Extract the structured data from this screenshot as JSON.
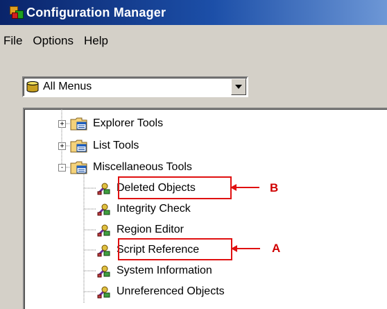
{
  "window": {
    "title": "Configuration Manager"
  },
  "menu": {
    "items": [
      "File",
      "Options",
      "Help"
    ]
  },
  "combo": {
    "value": "All Menus",
    "icon": "database-icon"
  },
  "tree": {
    "nodes": [
      {
        "label": "Explorer Tools",
        "type": "folder",
        "expander": "+"
      },
      {
        "label": "List Tools",
        "type": "folder",
        "expander": "+"
      },
      {
        "label": "Miscellaneous Tools",
        "type": "folder",
        "expander": "-"
      },
      {
        "label": "Deleted Objects",
        "type": "script",
        "annotation": "B"
      },
      {
        "label": "Integrity Check",
        "type": "script"
      },
      {
        "label": "Region Editor",
        "type": "script"
      },
      {
        "label": "Script Reference",
        "type": "script",
        "annotation": "A"
      },
      {
        "label": "System Information",
        "type": "script"
      },
      {
        "label": "Unreferenced Objects",
        "type": "script"
      }
    ]
  },
  "annotations": [
    {
      "letter": "B",
      "target": "Deleted Objects"
    },
    {
      "letter": "A",
      "target": "Script Reference"
    }
  ],
  "colors": {
    "titlebar_start": "#0a246a",
    "titlebar_end": "#6d97d6",
    "annotation": "#e01010",
    "face": "#d4d0c8"
  }
}
